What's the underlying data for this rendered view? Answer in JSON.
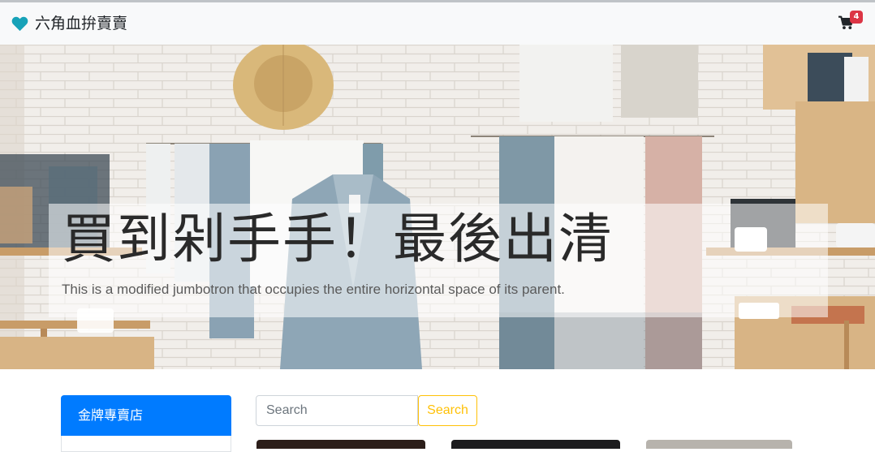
{
  "brand": {
    "name": "六角血拚賣賣",
    "icon": "heart-icon",
    "color": "#17a2b8"
  },
  "cart": {
    "icon": "shopping-cart-icon",
    "count": "4"
  },
  "hero": {
    "title": "買到剁手手！最後出清",
    "lead": "This is a modified jumbotron that occupies the entire horizontal space of its parent."
  },
  "sidebar": {
    "items": [
      {
        "label": "金牌專賣店",
        "active": true
      }
    ]
  },
  "search": {
    "placeholder": "Search",
    "button_label": "Search"
  },
  "colors": {
    "primary": "#007bff",
    "warning": "#ffc107",
    "danger": "#dc3545",
    "navbar_bg": "#f8f9fa"
  }
}
